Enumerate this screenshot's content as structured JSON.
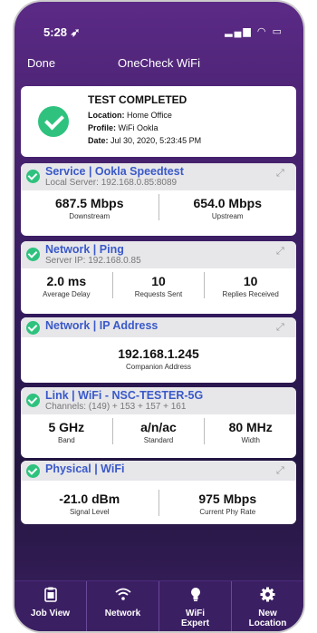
{
  "status": {
    "time": "5:28 ➶"
  },
  "nav": {
    "done": "Done",
    "title": "OneCheck WiFi"
  },
  "summary": {
    "heading": "TEST COMPLETED",
    "location_label": "Location:",
    "location": "Home Office",
    "profile_label": "Profile:",
    "profile": "WiFi Ookla",
    "date_label": "Date:",
    "date": "Jul 30, 2020, 5:23:45 PM"
  },
  "service": {
    "title": "Service | Ookla Speedtest",
    "subtitle": "Local Server: 192.168.0.85:8089",
    "metrics": [
      {
        "value": "687.5 Mbps",
        "label": "Downstream"
      },
      {
        "value": "654.0 Mbps",
        "label": "Upstream"
      }
    ]
  },
  "ping": {
    "title": "Network | Ping",
    "subtitle": "Server IP: 192.168.0.85",
    "metrics": [
      {
        "value": "2.0 ms",
        "label": "Average Delay"
      },
      {
        "value": "10",
        "label": "Requests Sent"
      },
      {
        "value": "10",
        "label": "Replies Received"
      }
    ]
  },
  "ip": {
    "title": "Network | IP Address",
    "metrics": [
      {
        "value": "192.168.1.245",
        "label": "Companion Address"
      }
    ]
  },
  "link": {
    "title": "Link | WiFi - NSC-TESTER-5G",
    "subtitle": "Channels: (149) + 153 + 157 + 161",
    "metrics": [
      {
        "value": "5 GHz",
        "label": "Band"
      },
      {
        "value": "a/n/ac",
        "label": "Standard"
      },
      {
        "value": "80 MHz",
        "label": "Width"
      }
    ]
  },
  "physical": {
    "title": "Physical | WiFi",
    "metrics": [
      {
        "value": "-21.0 dBm",
        "label": "Signal Level"
      },
      {
        "value": "975 Mbps",
        "label": "Current Phy Rate"
      }
    ]
  },
  "tabs": [
    {
      "line1": "Job View",
      "line2": "",
      "icon": "clipboard-icon"
    },
    {
      "line1": "Network",
      "line2": "",
      "icon": "wifi-icon"
    },
    {
      "line1": "WiFi",
      "line2": "Expert",
      "icon": "lightbulb-icon"
    },
    {
      "line1": "New",
      "line2": "Location",
      "icon": "gear-icon"
    }
  ]
}
